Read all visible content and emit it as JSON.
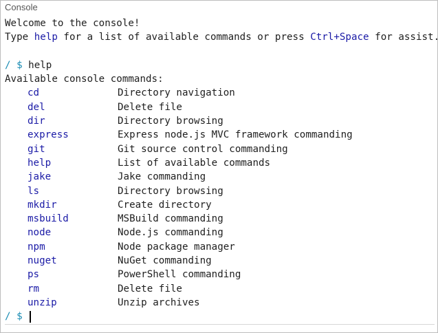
{
  "window": {
    "title": "Console"
  },
  "output": {
    "welcome": "Welcome to the console!",
    "hint_prefix": "Type ",
    "hint_cmd": "help",
    "hint_middle": " for a list of available commands or press ",
    "hint_shortcut": "Ctrl+Space",
    "hint_suffix": " for assist.",
    "prompt1": "/ $",
    "entered_command": "help",
    "available_header": "Available console commands:",
    "commands": [
      {
        "name": "cd",
        "desc": "Directory navigation"
      },
      {
        "name": "del",
        "desc": "Delete file"
      },
      {
        "name": "dir",
        "desc": "Directory browsing"
      },
      {
        "name": "express",
        "desc": "Express node.js MVC framework commanding"
      },
      {
        "name": "git",
        "desc": "Git source control commanding"
      },
      {
        "name": "help",
        "desc": "List of available commands"
      },
      {
        "name": "jake",
        "desc": "Jake commanding"
      },
      {
        "name": "ls",
        "desc": "Directory browsing"
      },
      {
        "name": "mkdir",
        "desc": "Create directory"
      },
      {
        "name": "msbuild",
        "desc": "MSBuild commanding"
      },
      {
        "name": "node",
        "desc": "Node.js commanding"
      },
      {
        "name": "npm",
        "desc": "Node package manager"
      },
      {
        "name": "nuget",
        "desc": "NuGet commanding"
      },
      {
        "name": "ps",
        "desc": "PowerShell commanding"
      },
      {
        "name": "rm",
        "desc": "Delete file"
      },
      {
        "name": "unzip",
        "desc": "Unzip archives"
      }
    ]
  },
  "input": {
    "prompt": "/ $",
    "value": ""
  },
  "colors": {
    "command": "#1a1aa6",
    "prompt": "#1a8cb3",
    "text": "#1e1e1e",
    "background": "#ffffff"
  }
}
